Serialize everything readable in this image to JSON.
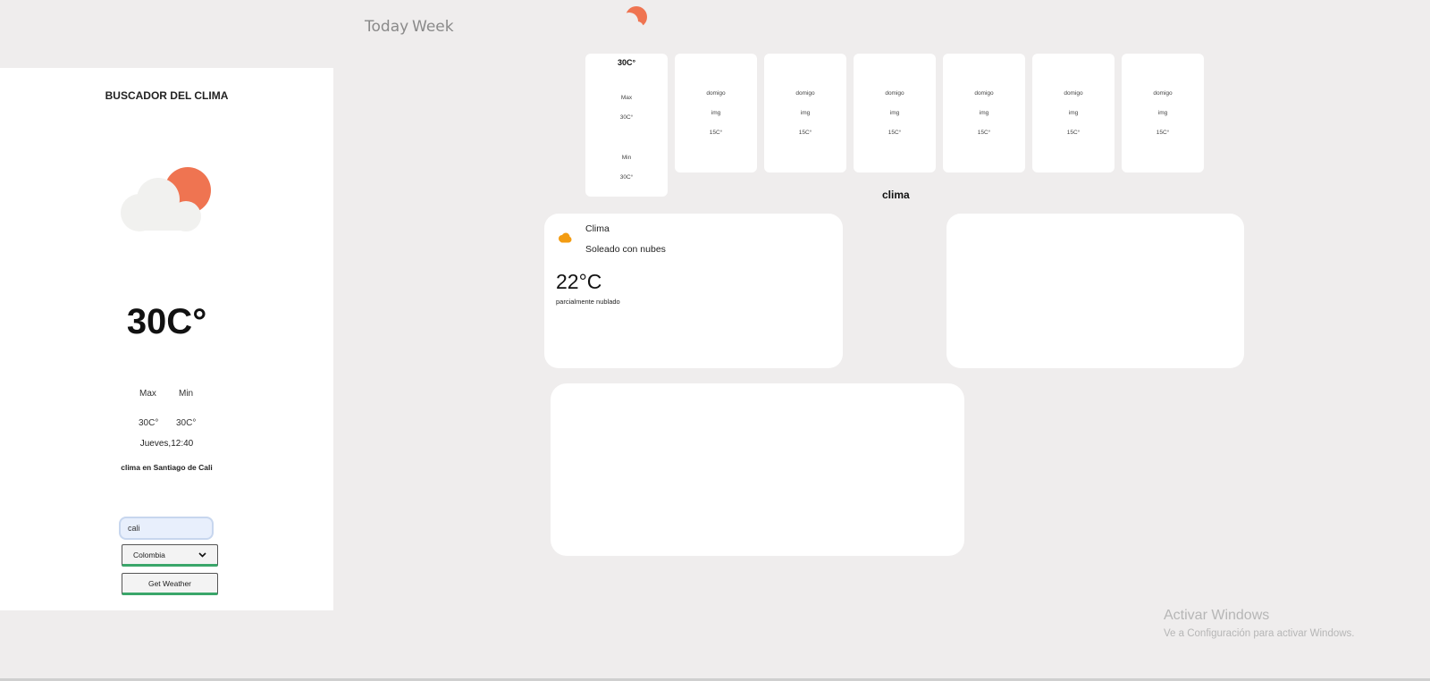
{
  "nav": {
    "today": "Today",
    "week": "Week"
  },
  "sidebar": {
    "title": "BUSCADOR DEL CLIMA",
    "temperature": "30C°",
    "max_label": "Max",
    "min_label": "Min",
    "max_value": "30C°",
    "min_value": "30C°",
    "datetime": "Jueves,12:40",
    "location": "clima en Santiago de Cali",
    "city_input_value": "cali",
    "country_selected": "Colombia",
    "get_weather_label": "Get Weather"
  },
  "today_card": {
    "temp": "30C°",
    "max_label": "Max",
    "max_value": "30C°",
    "min_label": "Min",
    "min_value": "30C°"
  },
  "week_cards": [
    {
      "day": "domigo",
      "img": "img",
      "temp": "15C°"
    },
    {
      "day": "domigo",
      "img": "img",
      "temp": "15C°"
    },
    {
      "day": "domigo",
      "img": "img",
      "temp": "15C°"
    },
    {
      "day": "domigo",
      "img": "img",
      "temp": "15C°"
    },
    {
      "day": "domigo",
      "img": "img",
      "temp": "15C°"
    },
    {
      "day": "domigo",
      "img": "img",
      "temp": "15C°"
    }
  ],
  "clima_heading": "clima",
  "clima_panel": {
    "title": "Clima",
    "condition": "Soleado con nubes",
    "temperature": "22°C",
    "description": "parcialmente nublado"
  },
  "watermark": {
    "line1": "Activar Windows",
    "line2": "Ve a Configuración para activar Windows."
  },
  "colors": {
    "sun": "#ef7451",
    "cloud": "#f1f1ef",
    "accent_green": "#3aa66a",
    "orange_cloud": "#f39c12"
  },
  "icons": [
    "partly-cloudy-icon",
    "cloud-icon",
    "chevron-down-icon"
  ]
}
